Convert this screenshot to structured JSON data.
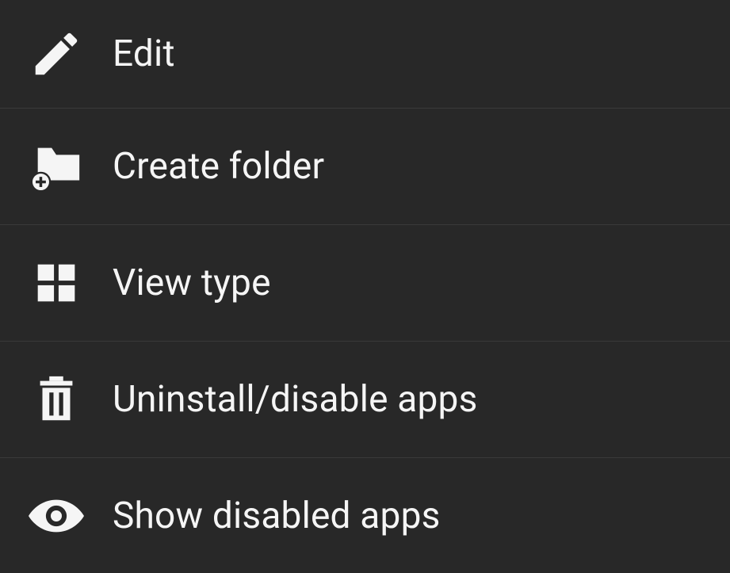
{
  "menu": {
    "items": [
      {
        "label": "Edit",
        "icon": "pencil-icon"
      },
      {
        "label": "Create folder",
        "icon": "folder-add-icon"
      },
      {
        "label": "View type",
        "icon": "grid-icon"
      },
      {
        "label": "Uninstall/disable apps",
        "icon": "trash-icon"
      },
      {
        "label": "Show disabled apps",
        "icon": "eye-icon"
      }
    ]
  }
}
